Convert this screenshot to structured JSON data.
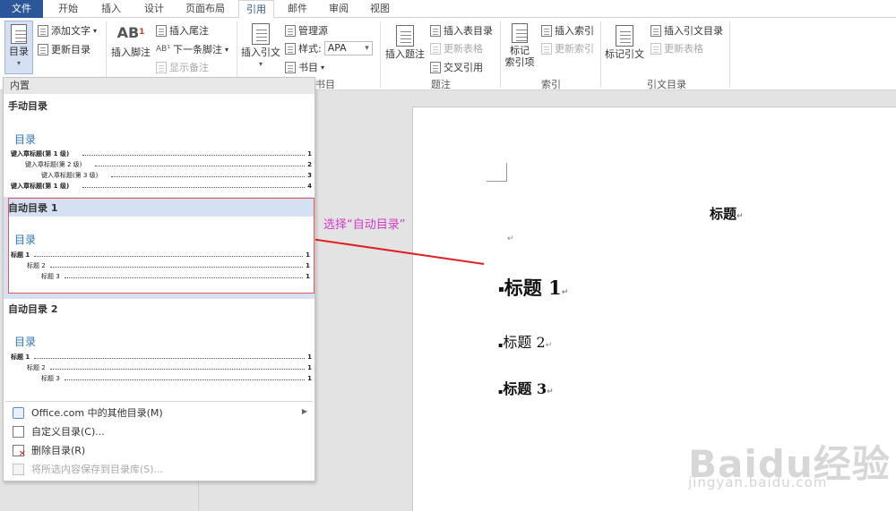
{
  "tabs": [
    "文件",
    "开始",
    "插入",
    "设计",
    "页面布局",
    "引用",
    "邮件",
    "审阅",
    "视图"
  ],
  "ribbon": {
    "toc_button": "目录",
    "add_text": "添加文字",
    "update_toc": "更新目录",
    "insert_footnote": "插入脚注",
    "insert_endnote": "插入尾注",
    "next_footnote": "下一条脚注",
    "show_notes": "显示备注",
    "insert_citation": "插入引文",
    "manage_sources": "管理源",
    "style_label": "样式:",
    "style_value": "APA",
    "bibliography": "书目",
    "bibliography_group": "书目",
    "insert_caption": "插入题注",
    "insert_table_of_figures": "插入表目录",
    "update_table": "更新表格",
    "cross_reference": "交叉引用",
    "captions_group": "题注",
    "mark_entry": "标记\n索引项",
    "insert_index": "插入索引",
    "update_index": "更新索引",
    "index_group": "索引",
    "mark_citation": "标记引文",
    "insert_table_of_authorities": "插入引文目录",
    "update_table2": "更新表格",
    "authorities_group": "引文目录"
  },
  "dropdown": {
    "header": "内置",
    "manual": {
      "title": "手动目录",
      "heading": "目录",
      "lines": [
        {
          "text": "键入章标题(第 1 级)",
          "page": "1"
        },
        {
          "text": "键入章标题(第 2 级)",
          "page": "2"
        },
        {
          "text": "键入章标题(第 3 级)",
          "page": "3"
        },
        {
          "text": "键入章标题(第 1 级)",
          "page": "4"
        }
      ]
    },
    "auto1": {
      "title": "自动目录 1",
      "heading": "目录",
      "lines": [
        {
          "text": "标题 1",
          "page": "1"
        },
        {
          "text": "标题 2",
          "page": "1"
        },
        {
          "text": "标题 3",
          "page": "1"
        }
      ]
    },
    "auto2": {
      "title": "自动目录 2",
      "heading": "目录",
      "lines": [
        {
          "text": "标题 1",
          "page": "1"
        },
        {
          "text": "标题 2",
          "page": "1"
        },
        {
          "text": "标题 3",
          "page": "1"
        }
      ]
    },
    "menu": [
      {
        "label": "Office.com 中的其他目录(M)"
      },
      {
        "label": "自定义目录(C)..."
      },
      {
        "label": "删除目录(R)"
      },
      {
        "label": "将所选内容保存到目录库(S)..."
      }
    ]
  },
  "annotation": "选择“自动目录”",
  "document": {
    "title": "标题",
    "h1": "标题 1",
    "h2": "标题 2",
    "h3": "标题 3",
    "para_mark": "↵",
    "bullet": "▪"
  },
  "watermark": {
    "main": "Baidu经验",
    "sub": "jingyan.baidu.com"
  },
  "colors": {
    "file_tab": "#2b579a",
    "toc_blue": "#2e74b5",
    "selection": "#d5e1f2",
    "annotation": "#d13bc9",
    "arrow": "#e02020"
  }
}
